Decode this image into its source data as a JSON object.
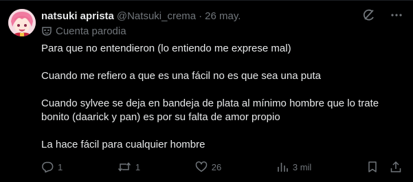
{
  "tweet": {
    "display_name": "natsuki aprista",
    "handle": "@Natsuki_crema",
    "separator": "·",
    "date": "26 may.",
    "parody_label": "Cuenta parodia",
    "paragraphs": [
      "Para que no entendieron (lo entiendo me exprese mal)",
      "Cuando me refiero a que es una fácil no es que sea una puta",
      "Cuando sylvee se deja en bandeja de plata al mínimo hombre que lo trate bonito (daarick y pan) es por su falta de amor propio",
      "La hace fácil para cualquier hombre"
    ],
    "replies": "1",
    "reposts": "1",
    "likes": "26",
    "views": "3 mil"
  },
  "icons": {
    "parody": "mask-icon",
    "grok": "grok-icon",
    "more": "more-icon",
    "reply": "reply-icon",
    "repost": "repost-icon",
    "like": "heart-icon",
    "views": "views-chart-icon",
    "bookmark": "bookmark-icon",
    "share": "share-icon"
  },
  "colors": {
    "background": "#000000",
    "text_primary": "#e7e9ea",
    "text_secondary": "#71767b"
  }
}
